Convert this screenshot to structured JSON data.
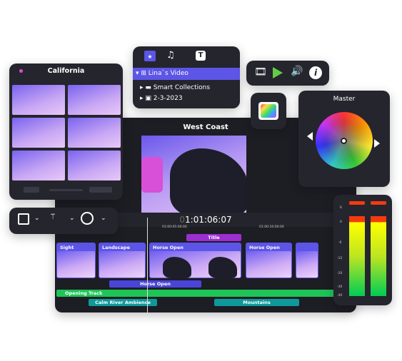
{
  "library": {
    "title": "California"
  },
  "browser": {
    "items": [
      {
        "label": "Lina`s Video",
        "selected": true
      },
      {
        "label": "Smart Collections"
      },
      {
        "label": "2-3-2023"
      }
    ]
  },
  "viewer": {
    "title": "West Coast",
    "timecode_dim": "0",
    "timecode": "1:01:06:07"
  },
  "ruler": {
    "ticks": [
      "01:00:05:00:00",
      "01:00:10:00:00"
    ]
  },
  "timeline": {
    "title_clip": "Title",
    "clips": [
      "Sight",
      "Landscape",
      "Horse Open",
      "Horse Open",
      ""
    ],
    "connected_clip": "Horse Open",
    "audio": [
      "Opening Track",
      "Calm River Ambience",
      "Mountains"
    ]
  },
  "color": {
    "title": "Master"
  },
  "meter": {
    "labels": [
      "6",
      "0",
      "-6",
      "-12",
      "-20",
      "-30",
      "-40"
    ]
  },
  "colors": {
    "accent": "#5c55e6",
    "panel": "#25252e",
    "title_clip": "#9b2fcf",
    "audio_green": "#1fc456",
    "audio_teal": "#0e9a9c"
  }
}
